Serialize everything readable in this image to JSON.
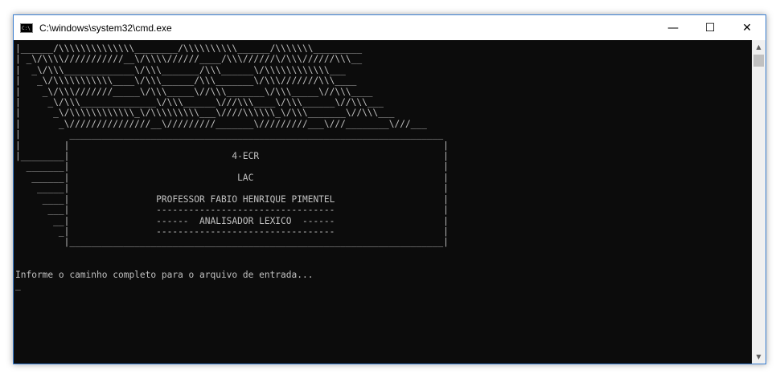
{
  "window": {
    "title": "C:\\windows\\system32\\cmd.exe",
    "icon": "cmd-icon",
    "controls": {
      "minimize": "—",
      "maximize": "☐",
      "close": "✕"
    }
  },
  "console": {
    "art_lines": [
      "|______/\\\\\\\\\\\\\\\\\\\\\\\\\\\\________/\\\\\\\\\\\\\\\\\\\\______/\\\\\\\\\\\\\\_________",
      "| _\\/\\\\\\\\///////////__\\/\\\\\\\\//////____/\\\\\\//////\\/\\\\\\//////\\\\\\__",
      "|  _\\/\\\\\\_____________\\/\\\\\\_______/\\\\\\______\\/\\\\\\\\\\\\\\\\\\\\\\\\___",
      "|   _\\/\\\\\\\\\\\\\\\\\\\\\\____\\/\\\\\\______/\\\\\\_______\\/\\\\\\///////\\\\\\____",
      "|    _\\/\\\\\\///////_____\\/\\\\\\_____\\//\\\\\\_______\\/\\\\\\_____\\//\\\\\\____",
      "|     _\\/\\\\\\______________\\/\\\\\\______\\///\\\\\\____\\/\\\\\\______\\//\\\\\\___",
      "|      _\\/\\\\\\\\\\\\\\\\\\\\\\\\_\\/\\\\\\\\\\\\\\\\\\___\\////\\\\\\\\\\\\_\\/\\\\\\_______\\//\\\\\\___",
      "|       _\\///////////////__\\/////////_______\\/////////___\\///________\\///___",
      "|         _____________________________________________________________________",
      "|        |                                                                     |",
      "|________|                              4-ECR                                  |",
      "  _______|                                                                     |",
      "   ______|                               LAC                                   |",
      "    _____|                                                                     |",
      "     ____|                PROFESSOR FABIO HENRIQUE PIMENTEL                    |",
      "      ___|                ---------------------------------                    |",
      "       __|                ------  ANALISADOR LEXICO  ------                    |",
      "        _|                ---------------------------------                    |",
      "         |_____________________________________________________________________|",
      "",
      "",
      "Informe o caminho completo para o arquivo de entrada...",
      "_"
    ]
  }
}
